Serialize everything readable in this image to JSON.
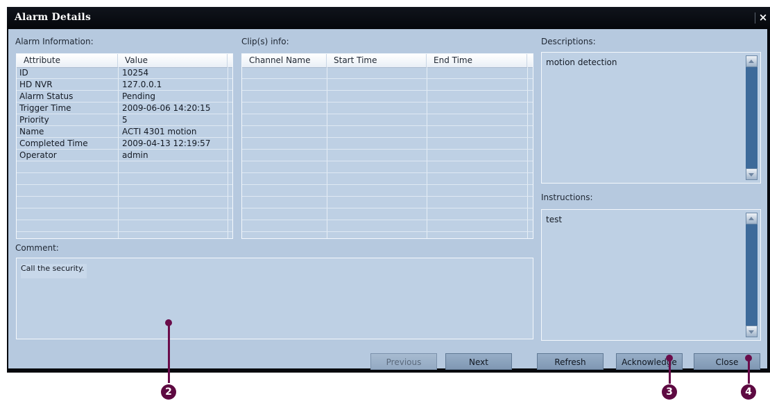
{
  "window": {
    "title": "Alarm Details",
    "close_glyph": "×"
  },
  "alarm_info": {
    "label": "Alarm Information:",
    "columns": [
      "Attribute",
      "Value"
    ],
    "rows": [
      [
        "ID",
        "10254"
      ],
      [
        "HD NVR",
        "127.0.0.1"
      ],
      [
        "Alarm Status",
        "Pending"
      ],
      [
        "Trigger Time",
        "2009-06-06 14:20:15"
      ],
      [
        "Priority",
        "5"
      ],
      [
        "Name",
        "ACTI 4301 motion"
      ],
      [
        "Completed Time",
        "2009-04-13 12:19:57"
      ],
      [
        "Operator",
        "admin"
      ]
    ]
  },
  "clips": {
    "label": "Clip(s) info:",
    "columns": [
      "Channel Name",
      "Start Time",
      "End Time"
    ]
  },
  "descriptions": {
    "label": "Descriptions:",
    "text": "motion detection"
  },
  "instructions": {
    "label": "Instructions:",
    "text": "test"
  },
  "comment": {
    "label": "Comment:",
    "value": "Call the security."
  },
  "buttons": {
    "previous": "Previous",
    "next": "Next",
    "refresh": "Refresh",
    "acknowledge": "Acknowledge",
    "close": "Close"
  },
  "callouts": [
    "2",
    "3",
    "4"
  ],
  "colors": {
    "client_bg": "#b6c9df",
    "callout": "#6a0c4a",
    "scroll_track": "#3d6a9a"
  }
}
